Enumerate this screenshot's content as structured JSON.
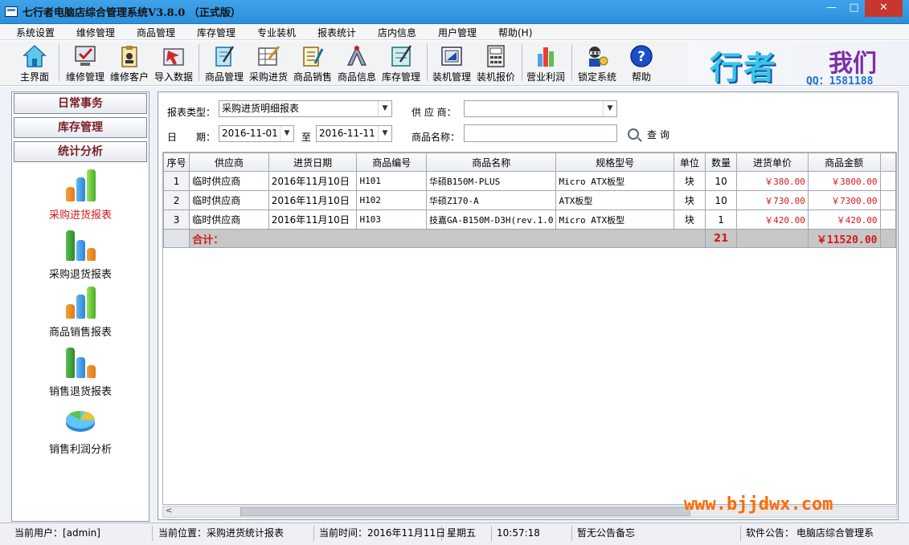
{
  "window": {
    "title": "七行者电脑店综合管理系统V3.8.0 （正式版）",
    "minimize": "—",
    "maximize": "□",
    "close": "✕"
  },
  "menu": [
    "系统设置",
    "维修管理",
    "商品管理",
    "库存管理",
    "专业装机",
    "报表统计",
    "店内信息",
    "用户管理",
    "帮助(H)"
  ],
  "toolbar": [
    {
      "label": "主界面",
      "icon": "home-icon"
    },
    {
      "label": "维修管理",
      "icon": "monitor-check-icon"
    },
    {
      "label": "维修客户",
      "icon": "clipboard-customer-icon"
    },
    {
      "label": "导入数据",
      "icon": "import-arrow-icon"
    },
    {
      "label": "商品管理",
      "icon": "notebook-pen-icon"
    },
    {
      "label": "采购进货",
      "icon": "spreadsheet-pen-icon"
    },
    {
      "label": "商品销售",
      "icon": "sales-list-icon"
    },
    {
      "label": "商品信息",
      "icon": "compass-draw-icon"
    },
    {
      "label": "库存管理",
      "icon": "inventory-book-icon"
    },
    {
      "label": "装机管理",
      "icon": "assembly-frame-icon"
    },
    {
      "label": "装机报价",
      "icon": "calculator-quote-icon"
    },
    {
      "label": "营业利润",
      "icon": "bar-chart-icon"
    },
    {
      "label": "锁定系统",
      "icon": "lock-person-icon"
    },
    {
      "label": "帮助",
      "icon": "help-question-icon"
    }
  ],
  "banner": {
    "text1": "行者",
    "text2": "我们",
    "qq": "QQ：1581188"
  },
  "sidebar": {
    "sections": [
      "日常事务",
      "库存管理",
      "统计分析"
    ],
    "items": [
      {
        "label": "采购进货报表",
        "icon": "bar-chart-icon",
        "active": true
      },
      {
        "label": "采购退货报表",
        "icon": "bar-chart-icon",
        "active": false
      },
      {
        "label": "商品销售报表",
        "icon": "bar-chart-icon",
        "active": false
      },
      {
        "label": "销售退货报表",
        "icon": "bar-chart-icon",
        "active": false
      },
      {
        "label": "销售利润分析",
        "icon": "profit-pie-icon",
        "active": false
      }
    ]
  },
  "filters": {
    "report_type_label": "报表类型：",
    "report_type_value": "采购进货明细报表",
    "supplier_label": "供 应 商：",
    "supplier_value": "",
    "date_label": "日　　期：",
    "date_from": "2016-11-01",
    "date_to_label": "至",
    "date_to": "2016-11-11",
    "product_name_label": "商品名称：",
    "product_name_value": "",
    "query_label": "查询"
  },
  "table": {
    "columns": [
      "序号",
      "供应商",
      "进货日期",
      "商品编号",
      "商品名称",
      "规格型号",
      "单位",
      "数量",
      "进货单价",
      "商品金额"
    ],
    "rows": [
      {
        "no": "1",
        "supplier": "临时供应商",
        "date": "2016年11月10日",
        "code": "H101",
        "name": "华硕B150M-PLUS",
        "spec": "Micro ATX板型",
        "unit": "块",
        "qty": "10",
        "price": "￥380.00",
        "amount": "￥3800.00"
      },
      {
        "no": "2",
        "supplier": "临时供应商",
        "date": "2016年11月10日",
        "code": "H102",
        "name": "华硕Z170-A",
        "spec": "ATX板型",
        "unit": "块",
        "qty": "10",
        "price": "￥730.00",
        "amount": "￥7300.00"
      },
      {
        "no": "3",
        "supplier": "临时供应商",
        "date": "2016年11月10日",
        "code": "H103",
        "name": "技嘉GA-B150M-D3H(rev.1.0",
        "spec": "Micro ATX板型",
        "unit": "块",
        "qty": "1",
        "price": "￥420.00",
        "amount": "￥420.00"
      }
    ],
    "total_label": "合计：",
    "total_qty": "21",
    "total_amount": "￥11520.00"
  },
  "watermark": "www.bjjdwx.com",
  "status": {
    "user": "当前用户：[admin]",
    "location": "当前位置：采购进货统计报表",
    "time_label": "当前时间：2016年11月11日",
    "weekday": "星期五",
    "clock": "10:57:18",
    "notice": "暂无公告备忘",
    "software_notice": "软件公告：",
    "software_text": "电脑店综合管理系"
  },
  "colors": {
    "accent_title": "#2b8fdc",
    "money_red": "#d21a1a",
    "watermark": "#ff6a00",
    "section_text": "#7a1e28"
  }
}
